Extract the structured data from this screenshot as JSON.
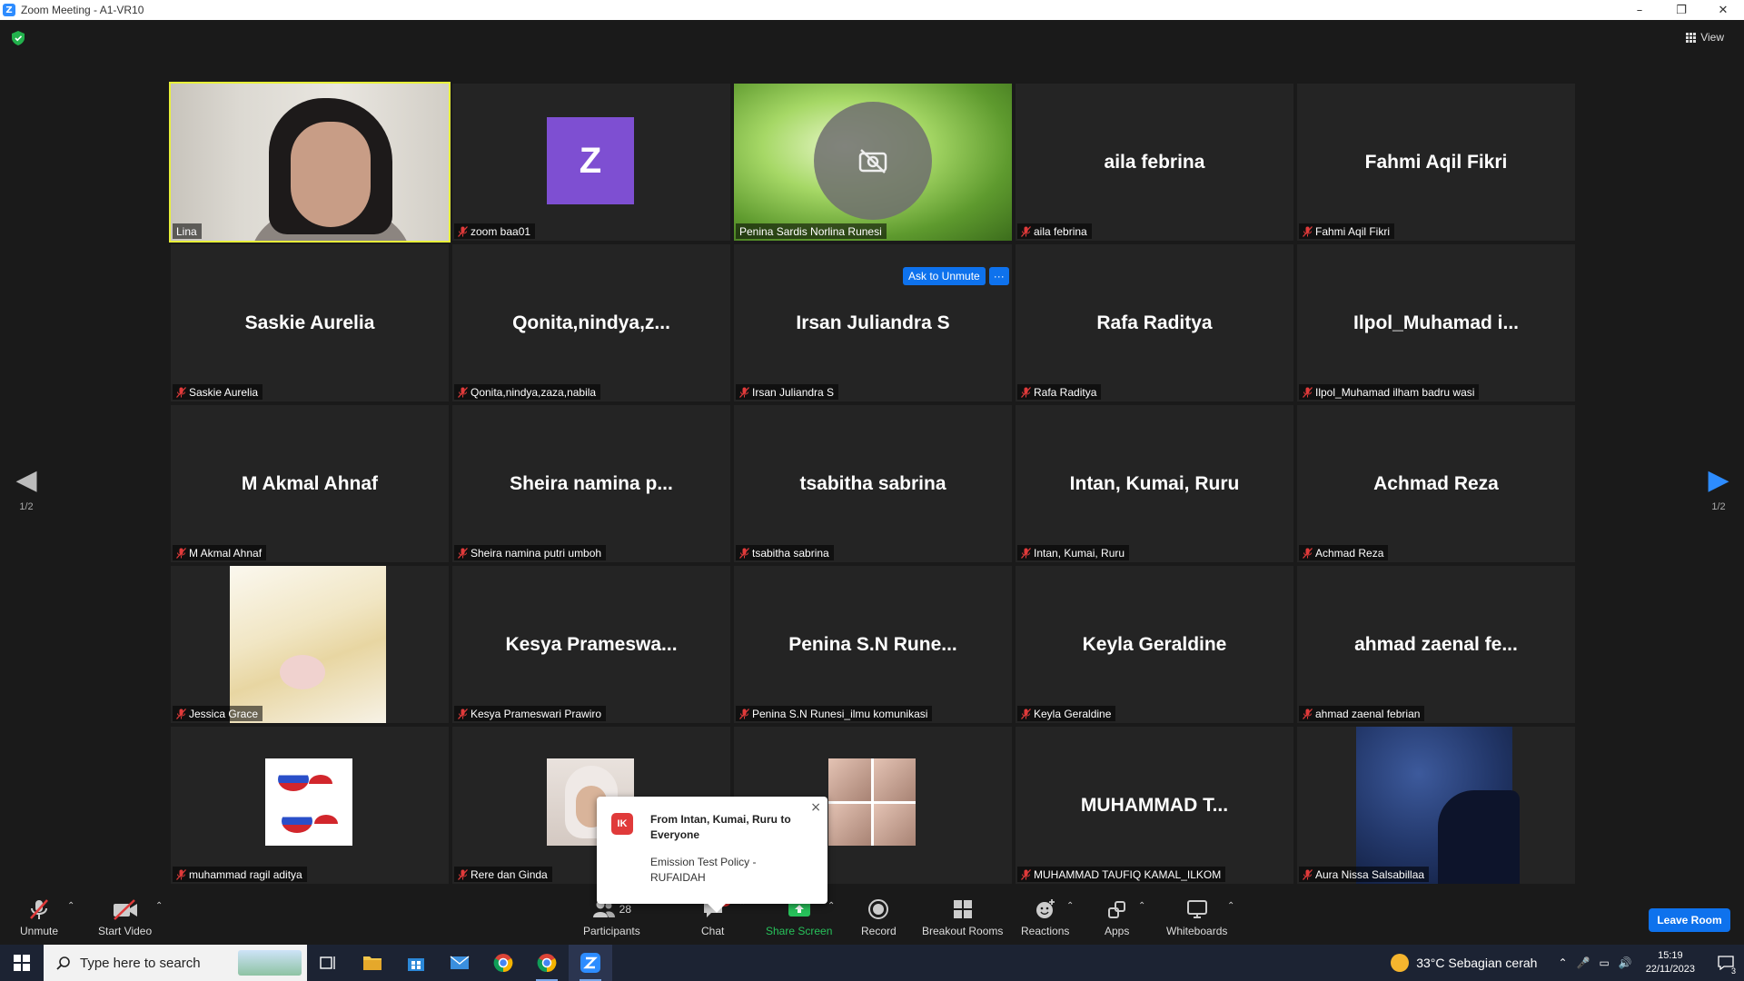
{
  "window": {
    "title": "Zoom Meeting - A1-VR10",
    "min": "–",
    "restore": "❐",
    "close": "✕"
  },
  "view_label": "View",
  "page_indicator_left": "1/2",
  "page_indicator_right": "1/2",
  "tiles": [
    {
      "big": "",
      "label": "Lina",
      "muted": false
    },
    {
      "big": "",
      "label": "zoom baa01",
      "muted": true,
      "avatar_letter": "Z"
    },
    {
      "big": "",
      "label": "Penina Sardis Norlina Runesi",
      "muted": false
    },
    {
      "big": "aila febrina",
      "label": "aila febrina",
      "muted": true
    },
    {
      "big": "Fahmi Aqil Fikri",
      "label": "Fahmi Aqil Fikri",
      "muted": true
    },
    {
      "big": "Saskie Aurelia",
      "label": "Saskie Aurelia",
      "muted": true
    },
    {
      "big": "Qonita,nindya,z...",
      "label": "Qonita,nindya,zaza,nabila",
      "muted": true
    },
    {
      "big": "Irsan Juliandra S",
      "label": "Irsan Juliandra S",
      "muted": true
    },
    {
      "big": "Rafa Raditya",
      "label": "Rafa Raditya",
      "muted": true
    },
    {
      "big": "Ilpol_Muhamad  i...",
      "label": "Ilpol_Muhamad ilham badru wasi",
      "muted": true
    },
    {
      "big": "M Akmal Ahnaf",
      "label": "M Akmal Ahnaf",
      "muted": true
    },
    {
      "big": "Sheira  namina  p...",
      "label": "Sheira namina putri umboh",
      "muted": true
    },
    {
      "big": "tsabitha sabrina",
      "label": "tsabitha sabrina",
      "muted": true
    },
    {
      "big": "Intan, Kumai, Ruru",
      "label": "Intan, Kumai, Ruru",
      "muted": true
    },
    {
      "big": "Achmad Reza",
      "label": "Achmad Reza",
      "muted": true
    },
    {
      "big": "",
      "label": "Jessica Grace",
      "muted": true
    },
    {
      "big": "Kesya  Prameswa...",
      "label": "Kesya Prameswari Prawiro",
      "muted": true
    },
    {
      "big": "Penina  S.N  Rune...",
      "label": "Penina S.N Runesi_ilmu komunikasi",
      "muted": true
    },
    {
      "big": "Keyla Geraldine",
      "label": "Keyla Geraldine",
      "muted": true
    },
    {
      "big": "ahmad  zaenal  fe...",
      "label": "ahmad zaenal febrian",
      "muted": true
    },
    {
      "big": "",
      "label": "muhammad ragil aditya",
      "muted": true
    },
    {
      "big": "",
      "label": "Rere dan Ginda",
      "muted": true
    },
    {
      "big": "",
      "label": "na",
      "muted": false
    },
    {
      "big": "MUHAMMAD  T...",
      "label": "MUHAMMAD TAUFIQ KAMAL_ILKOM",
      "muted": true
    },
    {
      "big": "",
      "label": "Aura Nissa Salsabillaa",
      "muted": true
    }
  ],
  "ask_to_unmute": {
    "label": "Ask to Unmute",
    "more": "···"
  },
  "chat_popup": {
    "avatar": "IK",
    "from": "From Intan, Kumai, Ruru to Everyone",
    "message": "Emission Test Policy - RUFAIDAH",
    "close": "×"
  },
  "toolbar": {
    "unmute": "Unmute",
    "start_video": "Start Video",
    "participants": "Participants",
    "participants_count": "28",
    "chat": "Chat",
    "chat_badge": "1",
    "share_screen": "Share Screen",
    "record": "Record",
    "breakout_rooms": "Breakout Rooms",
    "reactions": "Reactions",
    "apps": "Apps",
    "whiteboards": "Whiteboards",
    "leave_room": "Leave Room",
    "caret": "⌃"
  },
  "taskbar": {
    "search_placeholder": "Type here to search",
    "weather": "33°C  Sebagian cerah",
    "time": "15:19",
    "date": "22/11/2023",
    "notif_count": "3"
  },
  "colors": {
    "active_speaker": "#e8f03a",
    "accent": "#0e72ed",
    "share_green": "#27c15a",
    "muted_red": "#e03a3a"
  }
}
